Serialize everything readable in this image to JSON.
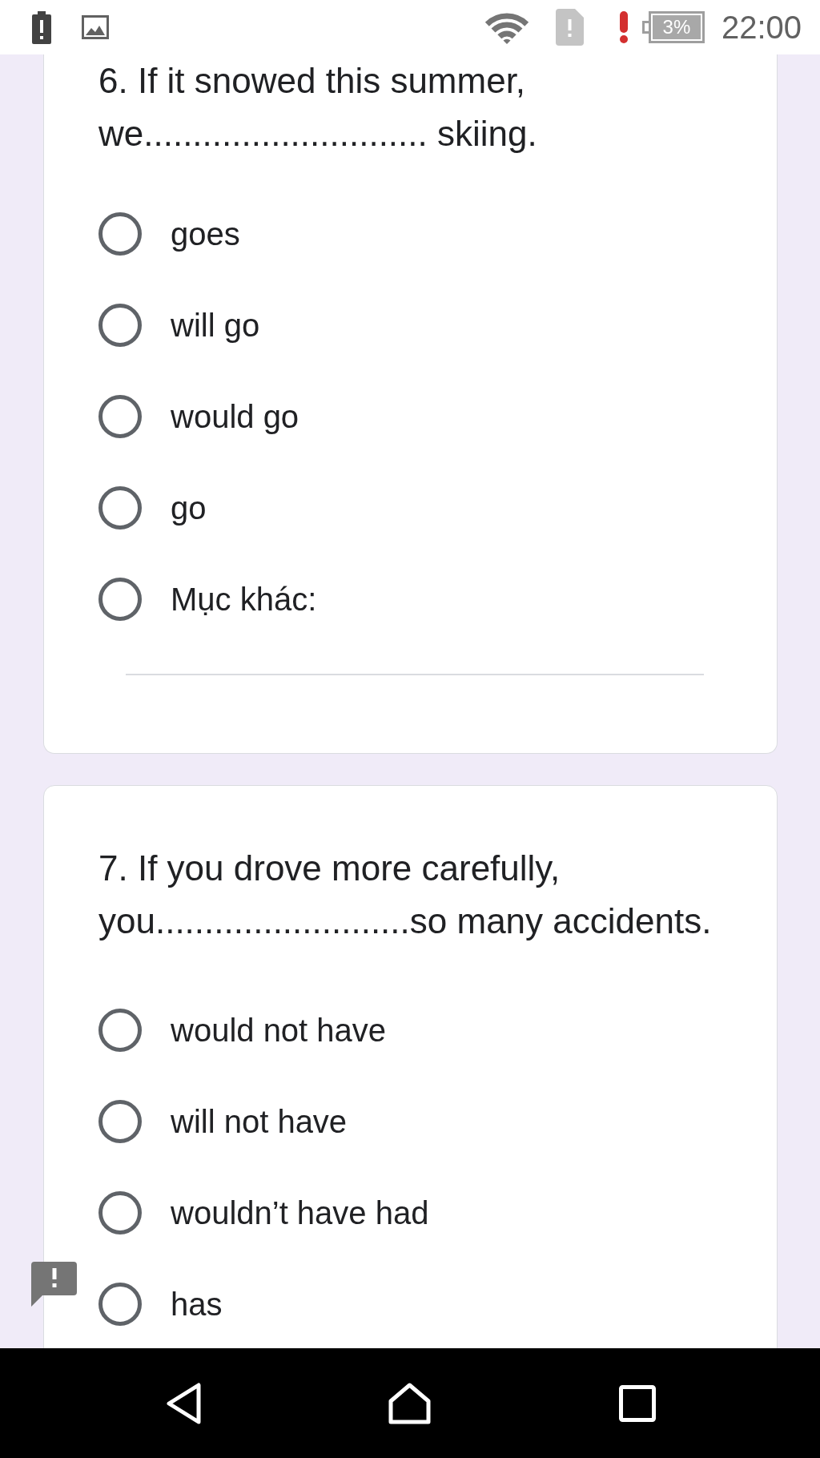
{
  "status_bar": {
    "battery_text": "3%",
    "time": "22:00"
  },
  "questions": [
    {
      "title": "6. If it snowed this summer, we............................. skiing.",
      "options": [
        {
          "kind": "choice",
          "label": "goes",
          "selected": false
        },
        {
          "kind": "choice",
          "label": "will go",
          "selected": false
        },
        {
          "kind": "choice",
          "label": "would go",
          "selected": false
        },
        {
          "kind": "choice",
          "label": "go",
          "selected": false
        },
        {
          "kind": "other",
          "label": "Mục khác:",
          "selected": false
        }
      ]
    },
    {
      "title": "7. If you drove more carefully, you..........................so many accidents.",
      "options": [
        {
          "kind": "choice",
          "label": "would not have",
          "selected": false
        },
        {
          "kind": "choice",
          "label": "will not have",
          "selected": false
        },
        {
          "kind": "choice",
          "label": "wouldn’t have had",
          "selected": false
        },
        {
          "kind": "choice",
          "label": "has",
          "selected": false
        }
      ]
    }
  ]
}
